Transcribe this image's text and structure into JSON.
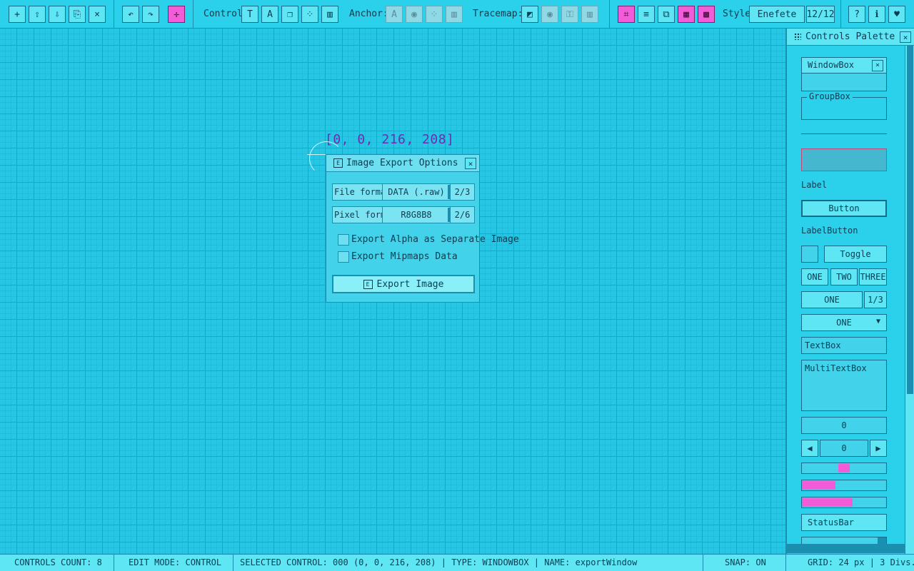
{
  "toolbar": {
    "control_label": "Control:",
    "anchor_label": "Anchor:",
    "tracemap_label": "Tracemap:",
    "style_label": "Style:",
    "style_value": "Enefete",
    "style_counter": "12/12",
    "colors": {
      "accent_pink": "#f25cd8",
      "button": "#5ee6f5"
    }
  },
  "canvas": {
    "coord_text": "[0, 0, 216, 208]",
    "window": {
      "title": "Image Export Options",
      "file_format_label": "File format:",
      "file_format_value": "DATA (.raw)",
      "file_format_count": "2/3",
      "pixel_format_label": "Pixel format",
      "pixel_format_value": "R8G8B8",
      "pixel_format_count": "2/6",
      "check_alpha_label": "Export Alpha as Separate Image",
      "check_mipmaps_label": "Export Mipmaps Data",
      "export_button_label": "Export Image"
    }
  },
  "palette": {
    "title": "Controls Palette",
    "windowbox": "WindowBox",
    "groupbox": "GroupBox",
    "label": "Label",
    "button": "Button",
    "labelbutton": "LabelButton",
    "toggle": "Toggle",
    "group_one": "ONE",
    "group_two": "TWO",
    "group_three": "THREE",
    "combo_value": "ONE",
    "combo_count": "1/3",
    "dropdown_value": "ONE",
    "textbox": "TextBox",
    "multitextbox": "MultiTextBox",
    "valuebox": "0",
    "spinner": "0",
    "statusbar": "StatusBar",
    "slider_level": 0.5,
    "sliderbar_level": 0.4,
    "progress_level": 0.6
  },
  "status": {
    "controls_count": "CONTROLS COUNT: 8",
    "edit_mode": "EDIT MODE: CONTROL",
    "selected": "SELECTED CONTROL: 000  (0, 0, 216, 208)  | TYPE: WINDOWBOX | NAME: exportWindow",
    "snap": "SNAP: ON",
    "grid": "GRID: 24 px | 3 Divs."
  }
}
